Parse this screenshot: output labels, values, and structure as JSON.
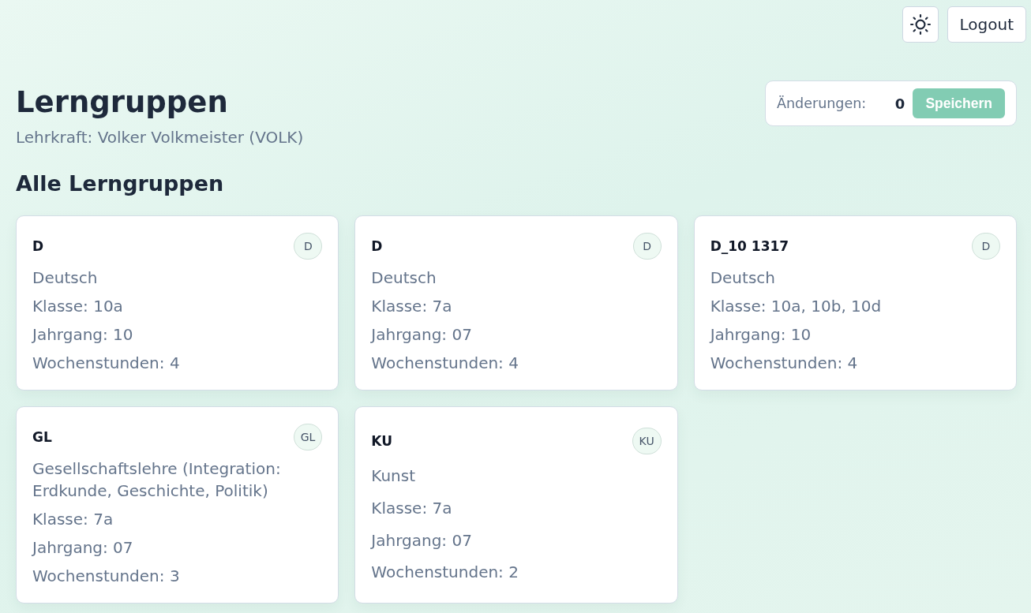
{
  "top_bar": {
    "logout_button": "Logout"
  },
  "header": {
    "title": "Lerngruppen",
    "subtitle": "Lehrkraft: Volker Volkmeister (VOLK)"
  },
  "changes_panel": {
    "label": "Änderungen:",
    "count": "0",
    "save_button": {
      "label": "Speichern",
      "disabled": true
    }
  },
  "section_title": "Alle Lerngruppen",
  "groups": [
    {
      "code": "D",
      "badge": "D",
      "subject": "Deutsch",
      "class": "Klasse: 10a",
      "year": "Jahrgang: 10",
      "hours": "Wochenstunden: 4"
    },
    {
      "code": "D",
      "badge": "D",
      "subject": "Deutsch",
      "class": "Klasse: 7a",
      "year": "Jahrgang: 07",
      "hours": "Wochenstunden: 4"
    },
    {
      "code": "D_10 1317",
      "badge": "D",
      "subject": "Deutsch",
      "class": "Klasse: 10a, 10b, 10d",
      "year": "Jahrgang: 10",
      "hours": "Wochenstunden: 4"
    },
    {
      "code": "GL",
      "badge": "GL",
      "subject": "Gesellschaftslehre (Integration: Erdkunde, Geschichte, Politik)",
      "class": "Klasse: 7a",
      "year": "Jahrgang: 07",
      "hours": "Wochenstunden: 3"
    },
    {
      "code": "KU",
      "badge": "KU",
      "subject": "Kunst",
      "class": "Klasse: 7a",
      "year": "Jahrgang: 07",
      "hours": "Wochenstunden: 2"
    }
  ]
}
